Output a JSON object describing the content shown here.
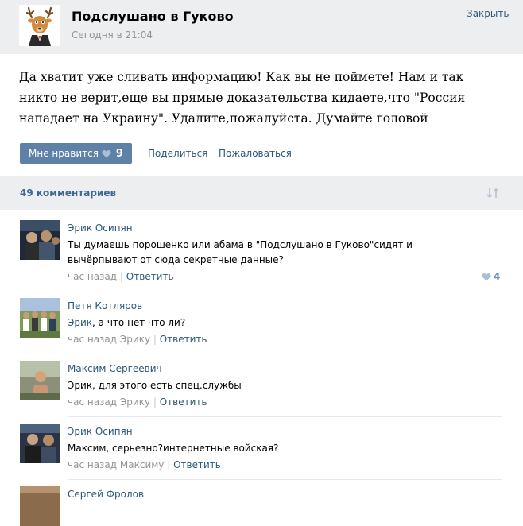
{
  "header": {
    "group_name": "Подслушано в Гуково",
    "post_date": "Сегодня в 21:04",
    "close_label": "Закрыть"
  },
  "post": {
    "text": "Да хватит уже сливать информацию! Как вы не поймете! Нам и так никто не верит,еще вы прямые доказательства кидаете,что \"Россия нападает на Украину\". Удалите,пожалуйста. Думайте головой",
    "like_label": "Мне нравится",
    "like_count": "9",
    "share_label": "Поделиться",
    "report_label": "Пожаловаться"
  },
  "comments_header": {
    "count_label": "49 комментариев"
  },
  "comments": [
    {
      "author": "Эрик Осипян",
      "text": "Ты думаешь порошенко или абама в \"Подслушано в Гуково\"сидят и вычёрпывают от сюда секретные данные?",
      "time": "час назад",
      "separator": "|",
      "reply_label": "Ответить",
      "likes": "4"
    },
    {
      "author": "Петя Котляров",
      "mention": "Эрик",
      "text": ", а что нет что ли?",
      "time": "час назад Эрику",
      "separator": "|",
      "reply_label": "Ответить"
    },
    {
      "author": "Максим Сергеевич",
      "text": "Эрик, для этого есть спец.службы",
      "time": "час назад Эрику",
      "separator": "|",
      "reply_label": "Ответить"
    },
    {
      "author": "Эрик Осипян",
      "text": "Максим, серьезно?интернетные войская?",
      "time": "час назад Максиму",
      "separator": "|",
      "reply_label": "Ответить"
    },
    {
      "author": "Сергей Фролов"
    }
  ],
  "colors": {
    "link": "#2b587a",
    "like_button": "#5e81a8",
    "header_bg": "#edeef0",
    "meta": "#939393"
  },
  "icons": [
    "deer-avatar-icon",
    "heart-icon",
    "sort-icon"
  ]
}
